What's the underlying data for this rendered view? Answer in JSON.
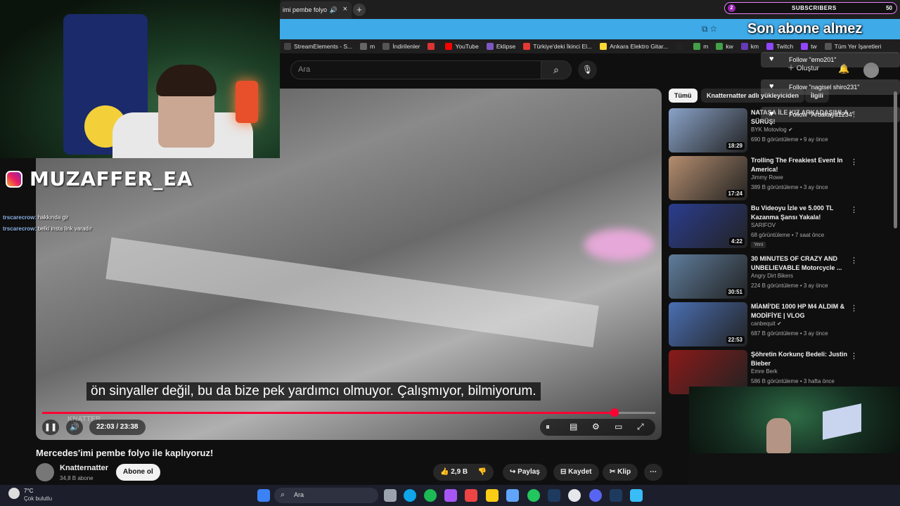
{
  "browser": {
    "tab_title": "imi pembe folyo",
    "new_tab_symbol": "+",
    "bookmarks": [
      {
        "label": "StreamElements - S...",
        "color": "#444"
      },
      {
        "label": "m",
        "color": "#666"
      },
      {
        "label": "İndirilenler",
        "color": "#555"
      },
      {
        "label": "",
        "color": "#d33"
      },
      {
        "label": "YouTube",
        "color": "#f00"
      },
      {
        "label": "Eklipse",
        "color": "#7e57c2"
      },
      {
        "label": "Türkiye'deki İkinci El...",
        "color": "#e53935"
      },
      {
        "label": "Ankara Elektro Gitar...",
        "color": "#fdd835"
      },
      {
        "label": "",
        "color": "#222"
      },
      {
        "label": "m",
        "color": "#43a047"
      },
      {
        "label": "kw",
        "color": "#43a047"
      },
      {
        "label": "km",
        "color": "#673ab7"
      },
      {
        "label": "Twitch",
        "color": "#9146ff"
      },
      {
        "label": "tw",
        "color": "#9146ff"
      },
      {
        "label": "Tüm Yer İşaretleri",
        "color": "#555"
      }
    ]
  },
  "overlay": {
    "subscribers_label": "SUBSCRIBERS",
    "subscribers_count": "2",
    "subscribers_target": "50",
    "son_abone": "Son abone almez",
    "instagram": "MUZAFFER_EA",
    "follows": [
      "Follow \"emo201\"",
      "Follow \"nagisel shiro231\"",
      "Follow \"Ardakaya1234\""
    ],
    "chat": [
      {
        "user": "trscarecrow",
        "msg": ": hakkında gir"
      },
      {
        "user": "trscarecrow",
        "msg": ": belki insta link varadır"
      }
    ]
  },
  "yt": {
    "search_placeholder": "Ara",
    "create_label": "Oluştur",
    "chips": [
      "Tümü",
      "Knatternatter adlı yükleyiciden",
      "İlgili"
    ],
    "video": {
      "subtitle": "ön sinyaller değil, bu da bize pek yardımcı olmuyor. Çalışmıyor, bilmiyorum.",
      "time": "22:03 / 23:38",
      "progress": 0.933,
      "watermark": "KNATTER",
      "title": "Mercedes'imi pembe folyo ile kaplıyoruz!",
      "channel": "Knatternatter",
      "channel_subs": "34,8 B abone",
      "subscribe_label": "Abone ol",
      "likes": "2,9 B",
      "share_label": "Paylaş",
      "save_label": "Kaydet",
      "clip_label": "Klip"
    },
    "recommendations": [
      {
        "title": "NATAŞA İLE KIZ ARKADAŞIMLA SÜRÜŞ!",
        "channel": "BYK Motovlog",
        "verified": true,
        "meta": "690 B görüntüleme • 9 ay önce",
        "duration": "18:29",
        "new": "",
        "color": "#8aa3c9"
      },
      {
        "title": "Trolling The Freakiest Event In America!",
        "channel": "Jimmy Rowe",
        "verified": false,
        "meta": "389 B görüntüleme • 3 ay önce",
        "duration": "17:24",
        "new": "",
        "color": "#b58e6f"
      },
      {
        "title": "Bu Videoyu İzle ve 5.000 TL Kazanma Şansı Yakala!",
        "channel": "SARIFOV",
        "verified": false,
        "meta": "68 görüntüleme • 7 saat önce",
        "duration": "4:22",
        "new": "Yeni",
        "color": "#2b3d8f"
      },
      {
        "title": "30 MINUTES OF CRAZY AND UNBELIEVABLE Motorcycle ...",
        "channel": "Angry Dirt Bikers",
        "verified": false,
        "meta": "224 B görüntüleme • 3 ay önce",
        "duration": "30:51",
        "new": "",
        "color": "#5f7d9c"
      },
      {
        "title": "MİAMİ'DE 1000 HP M4 ALDIM & MODİFİYE | VLOG",
        "channel": "canbequit",
        "verified": true,
        "meta": "687 B görüntüleme • 3 ay önce",
        "duration": "22:53",
        "new": "",
        "color": "#4a6fb3"
      },
      {
        "title": "Şöhretin Korkunç Bedeli: Justin Bieber",
        "channel": "Emre Berk",
        "verified": false,
        "meta": "586 B görüntüleme • 3 hafta önce",
        "duration": "",
        "new": "",
        "color": "#8b1a1a"
      }
    ]
  },
  "taskbar": {
    "temp": "7°C",
    "weather": "Çok bulutlu",
    "search_label": "Ara"
  },
  "colors": {
    "accent_red": "#ff0033",
    "address_bar": "#3faae8"
  }
}
